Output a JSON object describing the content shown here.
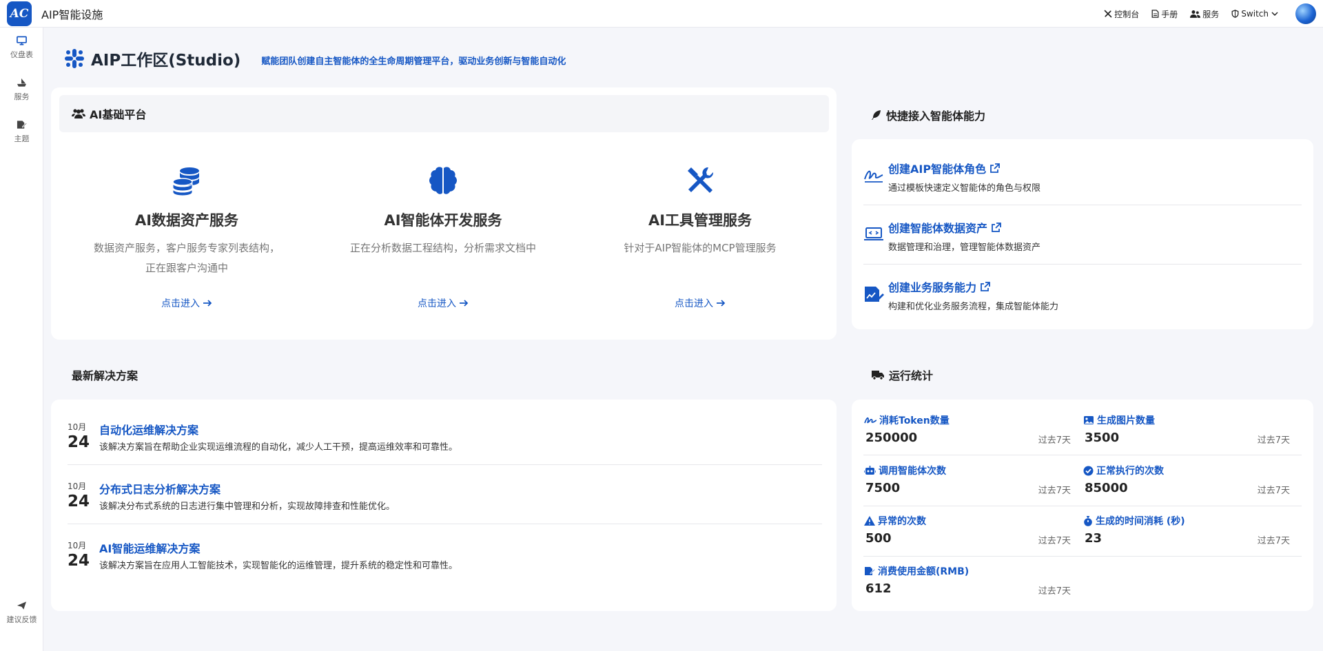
{
  "app": {
    "logo_text": "AC",
    "brand": "AIP智能设施"
  },
  "topnav": [
    {
      "label": "控制台",
      "icon": "tools-icon"
    },
    {
      "label": "手册",
      "icon": "document-icon"
    },
    {
      "label": "服务",
      "icon": "users-icon"
    },
    {
      "label": "Switch",
      "icon": "shield-icon"
    }
  ],
  "sidebar": {
    "items": [
      {
        "label": "仪盘表",
        "icon": "monitor-icon"
      },
      {
        "label": "服务",
        "icon": "ship-icon"
      },
      {
        "label": "主题",
        "icon": "edit-file-icon"
      }
    ],
    "feedback": "建议反馈"
  },
  "page": {
    "title": "AIP工作区(Studio)",
    "subtitle": "赋能团队创建自主智能体的全生命周期管理平台，驱动业务创新与智能自动化"
  },
  "platform": {
    "title": "AI基础平台",
    "services": [
      {
        "title": "AI数据资产服务",
        "desc": "数据资产服务，客户服务专家列表结构，正在跟客户沟通中",
        "link": "点击进入",
        "icon": "database-icon"
      },
      {
        "title": "AI智能体开发服务",
        "desc": "正在分析数据工程结构，分析需求文档中",
        "link": "点击进入",
        "icon": "brain-icon"
      },
      {
        "title": "AI工具管理服务",
        "desc": "针对于AIP智能体的MCP管理服务",
        "link": "点击进入",
        "icon": "tools-icon"
      }
    ]
  },
  "quick": {
    "title": "快捷接入智能体能力",
    "items": [
      {
        "title": "创建AIP智能体角色",
        "desc": "通过模板快速定义智能体的角色与权限",
        "icon": "signature-icon"
      },
      {
        "title": "创建智能体数据资产",
        "desc": "数据管理和治理，管理智能体数据资产",
        "icon": "laptop-code-icon"
      },
      {
        "title": "创建业务服务能力",
        "desc": "构建和优化业务服务流程，集成智能体能力",
        "icon": "chart-edit-icon"
      }
    ]
  },
  "solutions": {
    "title": "最新解决方案",
    "items": [
      {
        "month": "10月",
        "day": "24",
        "title": "自动化运维解决方案",
        "desc": "该解决方案旨在帮助企业实现运维流程的自动化，减少人工干预，提高运维效率和可靠性。"
      },
      {
        "month": "10月",
        "day": "24",
        "title": "分布式日志分析解决方案",
        "desc": "该解决分布式系统的日志进行集中管理和分析，实现故障排查和性能优化。"
      },
      {
        "month": "10月",
        "day": "24",
        "title": "AI智能运维解决方案",
        "desc": "该解决方案旨在应用人工智能技术，实现智能化的运维管理，提升系统的稳定性和可靠性。"
      }
    ]
  },
  "stats": {
    "title": "运行统计",
    "items": [
      {
        "label": "消耗Token数量",
        "value": "250000",
        "period": "过去7天",
        "icon": "signature-icon"
      },
      {
        "label": "生成图片数量",
        "value": "3500",
        "period": "过去7天",
        "icon": "image-icon"
      },
      {
        "label": "调用智能体次数",
        "value": "7500",
        "period": "过去7天",
        "icon": "robot-icon"
      },
      {
        "label": "正常执行的次数",
        "value": "85000",
        "period": "过去7天",
        "icon": "check-circle-icon"
      },
      {
        "label": "异常的次数",
        "value": "500",
        "period": "过去7天",
        "icon": "warning-icon"
      },
      {
        "label": "生成的时间消耗 (秒)",
        "value": "23",
        "period": "过去7天",
        "icon": "stopwatch-icon"
      },
      {
        "label": "消费使用金额(RMB)",
        "value": "612",
        "period": "过去7天",
        "icon": "edit-file-icon"
      }
    ]
  },
  "colors": {
    "primary": "#1657c4",
    "background": "#f5f6fa",
    "card": "#ffffff"
  }
}
